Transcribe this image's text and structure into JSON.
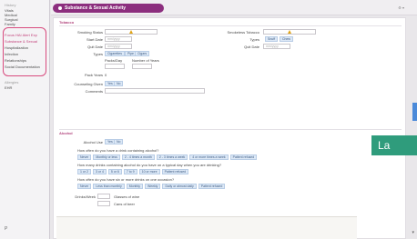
{
  "sidebar": {
    "items_top": [
      "Vitals",
      "Medical",
      "Surgical",
      "Family"
    ],
    "items_group": [
      "Focus HAI Alert Exp",
      "Substance & Sexual",
      "Hospitalization",
      "Infection",
      "Relationships",
      "Social Documentation"
    ],
    "items_after": [
      "Allergies",
      "EHR"
    ],
    "footer": "P"
  },
  "header": {
    "title": "Substance & Sexual Activity",
    "icons": "⚙ ▾"
  },
  "tobacco": {
    "section_title": "Tobacco",
    "smoking_status_label": "Smoking Status",
    "smokeless_status_label": "Smokeless Tobacco",
    "start_date_label": "Start Date",
    "quit_date_label": "Quit Date",
    "types_label": "Types",
    "types_left": [
      "Cigarettes",
      "Pipe",
      "Cigars"
    ],
    "types_right": [
      "Snuff",
      "Chew"
    ],
    "packs_per_day_label": "Packs/Day",
    "number_years_label": "Number of Years",
    "pack_years_label": "Pack Years",
    "pack_years_value": "0",
    "counseling_label": "Counseling Given",
    "yes": "Yes",
    "no": "No",
    "comments_label": "Comments",
    "date_placeholder": "mm/yyyy"
  },
  "alcohol": {
    "section_title": "Alcohol",
    "use_label": "Alcohol Use",
    "q1": "How often do you have a drink containing alcohol?",
    "q1_opts": [
      "Never",
      "Monthly or less",
      "2 - 4 times a month",
      "2 - 3 times a week",
      "4 or more times a week",
      "Patient refused"
    ],
    "q2": "How many drinks containing alcohol do you have on a typical day when you are drinking?",
    "q2_opts": [
      "1 or 2",
      "3 or 4",
      "5 or 6",
      "7 to 9",
      "10 or more",
      "Patient refused"
    ],
    "q3": "How often do you have six or more drinks on one occasion?",
    "q3_opts": [
      "Never",
      "Less than monthly",
      "Monthly",
      "Weekly",
      "Daily or almost daily",
      "Patient refused"
    ],
    "drinks_week_label": "Drinks/Week",
    "glasses_wine": "Glasses of wine",
    "cans_beer": "Cans of beer"
  },
  "overlay_badge": "La",
  "colors": {
    "accent": "#8c2e7e",
    "teal": "#2f9c7c",
    "blue": "#4b8ad9"
  }
}
